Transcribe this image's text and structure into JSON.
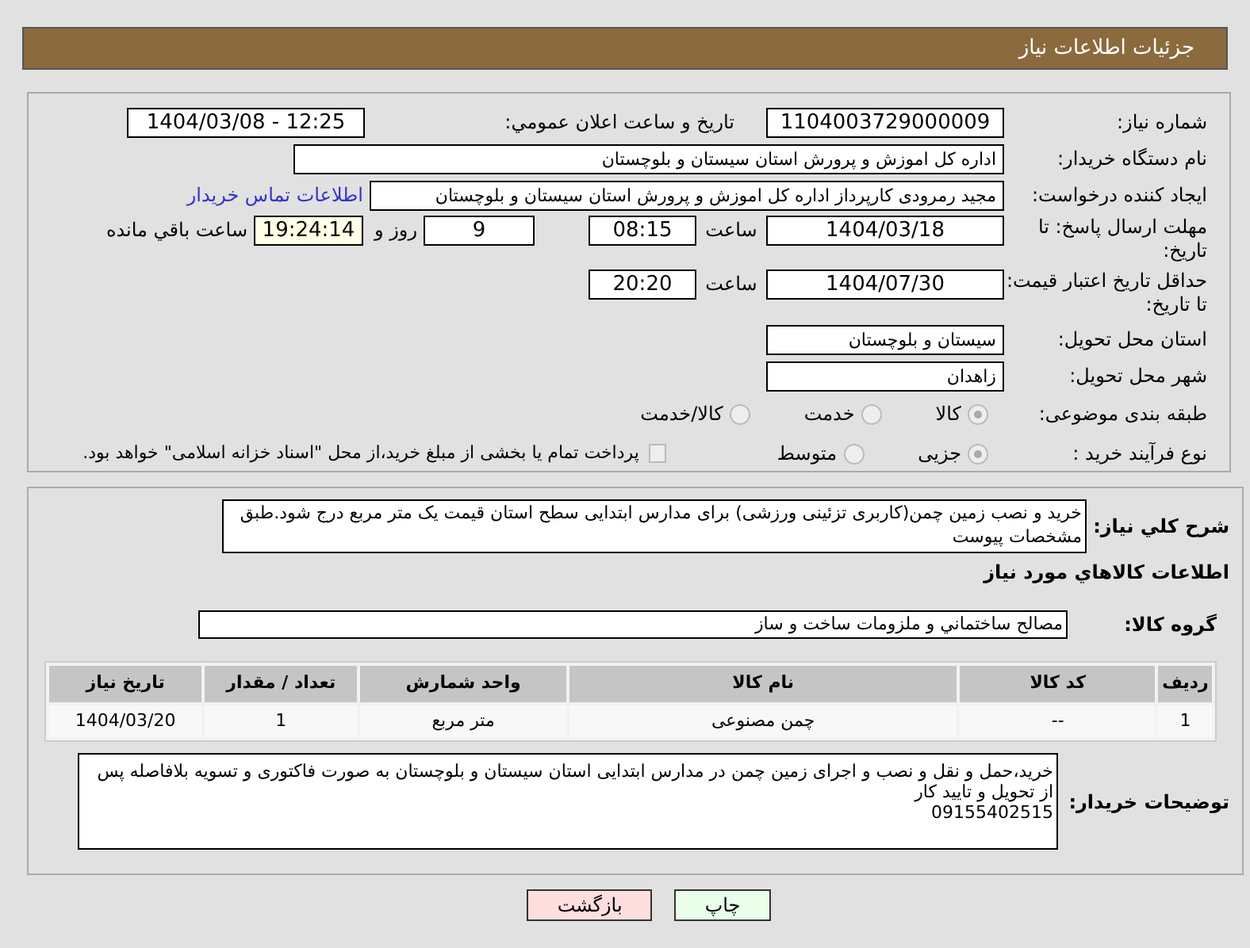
{
  "header": {
    "title": "جزئیات اطلاعات نیاز"
  },
  "need_number": {
    "label": "شماره نیاز:",
    "value": "1104003729000009"
  },
  "announce": {
    "label": "تاریخ و ساعت اعلان عمومي:",
    "value": "1404/03/08 - 12:25"
  },
  "buyer": {
    "label": "نام دستگاه خریدار:",
    "value": "اداره کل اموزش و پرورش استان سیستان و بلوچستان"
  },
  "creator": {
    "label": "ایجاد کننده درخواست:",
    "value": "مجید رمرودی کارپرداز اداره کل اموزش و پرورش استان سیستان و بلوچستان",
    "link": "اطلاعات تماس خریدار"
  },
  "deadline": {
    "label": "مهلت ارسال پاسخ: تا تاریخ:",
    "date": "1404/03/18",
    "time_label": "ساعت",
    "time": "08:15",
    "days": "9",
    "days_label": "روز و",
    "remaining": "19:24:14",
    "remaining_label": "ساعت باقي مانده"
  },
  "validity": {
    "label": "حداقل تاریخ اعتبار قیمت: تا تاریخ:",
    "date": "1404/07/30",
    "time_label": "ساعت",
    "time": "20:20"
  },
  "province": {
    "label": "استان محل تحویل:",
    "value": "سیستان و بلوچستان"
  },
  "city": {
    "label": "شهر محل تحویل:",
    "value": "زاهدان"
  },
  "category": {
    "label": "طبقه بندی موضوعی:",
    "options": [
      {
        "label": "کالا",
        "selected": true
      },
      {
        "label": "خدمت",
        "selected": false
      },
      {
        "label": "کالا/خدمت",
        "selected": false
      }
    ]
  },
  "process": {
    "label": "نوع فرآیند خرید :",
    "options": [
      {
        "label": "جزیی",
        "selected": true
      },
      {
        "label": "متوسط",
        "selected": false
      }
    ],
    "payment": {
      "checked": false,
      "text": "پرداخت تمام یا بخشی از مبلغ خرید،از محل \"اسناد خزانه اسلامی\" خواهد بود."
    }
  },
  "summary": {
    "label": "شرح کلي نیاز:",
    "value": "خرید و نصب زمین چمن(کاربری تزئینی ورزشی) برای مدارس ابتدایی سطح استان قیمت یک متر مربع درج شود.طبق مشخصات پیوست"
  },
  "goods_title": "اطلاعات کالاهاي مورد نیاز",
  "goods_group": {
    "label": "گروه کالا:",
    "value": "مصالح ساختماني و ملزومات ساخت و ساز"
  },
  "table": {
    "columns": [
      "ردیف",
      "کد کالا",
      "نام کالا",
      "واحد شمارش",
      "تعداد / مقدار",
      "تاریخ نیاز"
    ],
    "rows": [
      [
        "1",
        "--",
        "چمن مصنوعی",
        "متر مربع",
        "1",
        "1404/03/20"
      ]
    ]
  },
  "notes": {
    "label": "توضیحات خریدار:",
    "value": "خرید،حمل و نقل و نصب و اجرای زمین چمن در مدارس ابتدایی استان سیستان و بلوچستان به صورت فاکتوری و تسویه بلافاصله پس از تحویل و تایید کار\n09155402515"
  },
  "buttons": [
    {
      "label": "چاپ",
      "kind": "print"
    },
    {
      "label": "بازگشت",
      "kind": "back"
    }
  ]
}
